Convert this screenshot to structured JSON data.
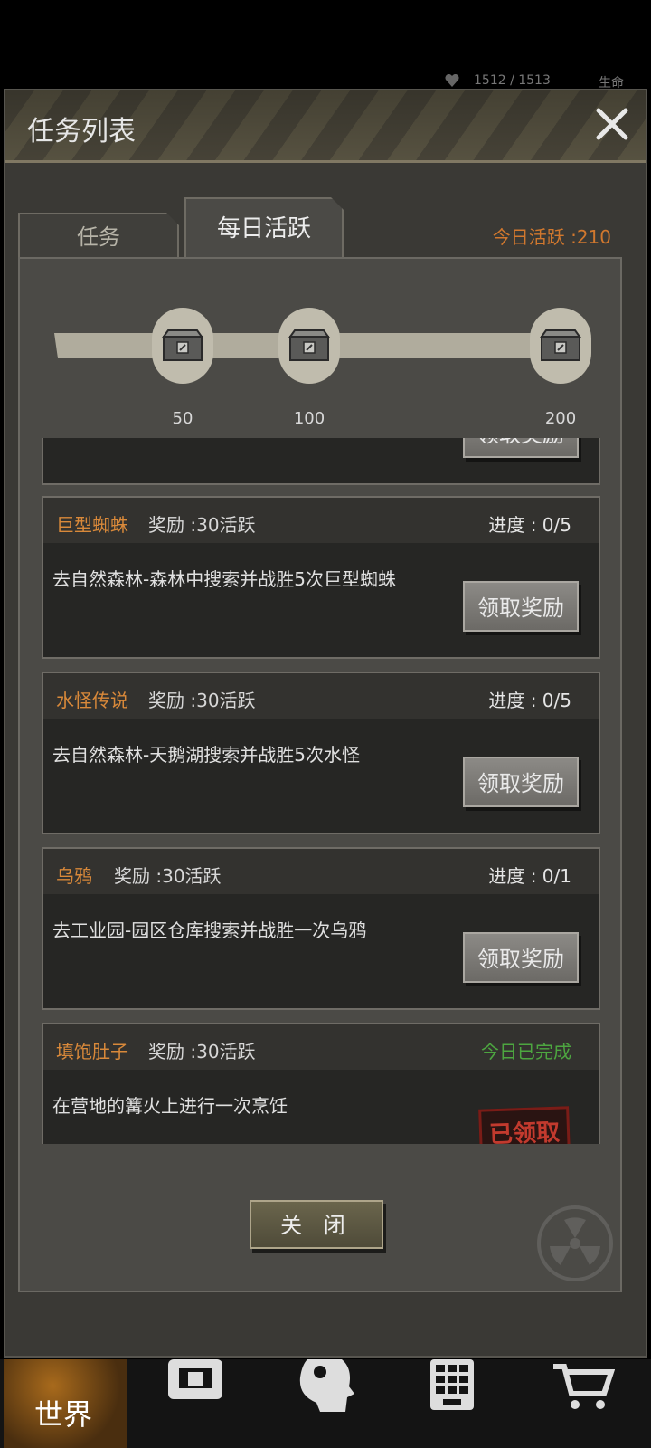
{
  "status": {
    "hp": "1512 / 1513",
    "life_label": "生命"
  },
  "dialog": {
    "title": "任务列表",
    "tabs": {
      "task": "任务",
      "daily": "每日活跃"
    },
    "today_active": "今日活跃 :210",
    "milestones": [
      "50",
      "100",
      "200"
    ],
    "tasks": [
      {
        "name": "巨型蜘蛛",
        "reward": "奖励 :30活跃",
        "progress": "进度 : 0/5",
        "desc": "去自然森林-森林中搜索并战胜5次巨型蜘蛛",
        "action": "领取奖励"
      },
      {
        "name": "水怪传说",
        "reward": "奖励 :30活跃",
        "progress": "进度 : 0/5",
        "desc": "去自然森林-天鹅湖搜索并战胜5次水怪",
        "action": "领取奖励"
      },
      {
        "name": "乌鸦",
        "reward": "奖励 :30活跃",
        "progress": "进度 : 0/1",
        "desc": "去工业园-园区仓库搜索并战胜一次乌鸦",
        "action": "领取奖励"
      },
      {
        "name": "填饱肚子",
        "reward": "奖励 :30活跃",
        "progress": "今日已完成",
        "desc": "在营地的篝火上进行一次烹饪",
        "stamp": "已领取"
      }
    ],
    "partial_button": "领取奖励",
    "close_button": "关 闭"
  },
  "nav": {
    "world": "世界"
  },
  "colors": {
    "accent_orange": "#d9893a",
    "done_green": "#4da640",
    "stamp_red": "#c23a2e"
  }
}
